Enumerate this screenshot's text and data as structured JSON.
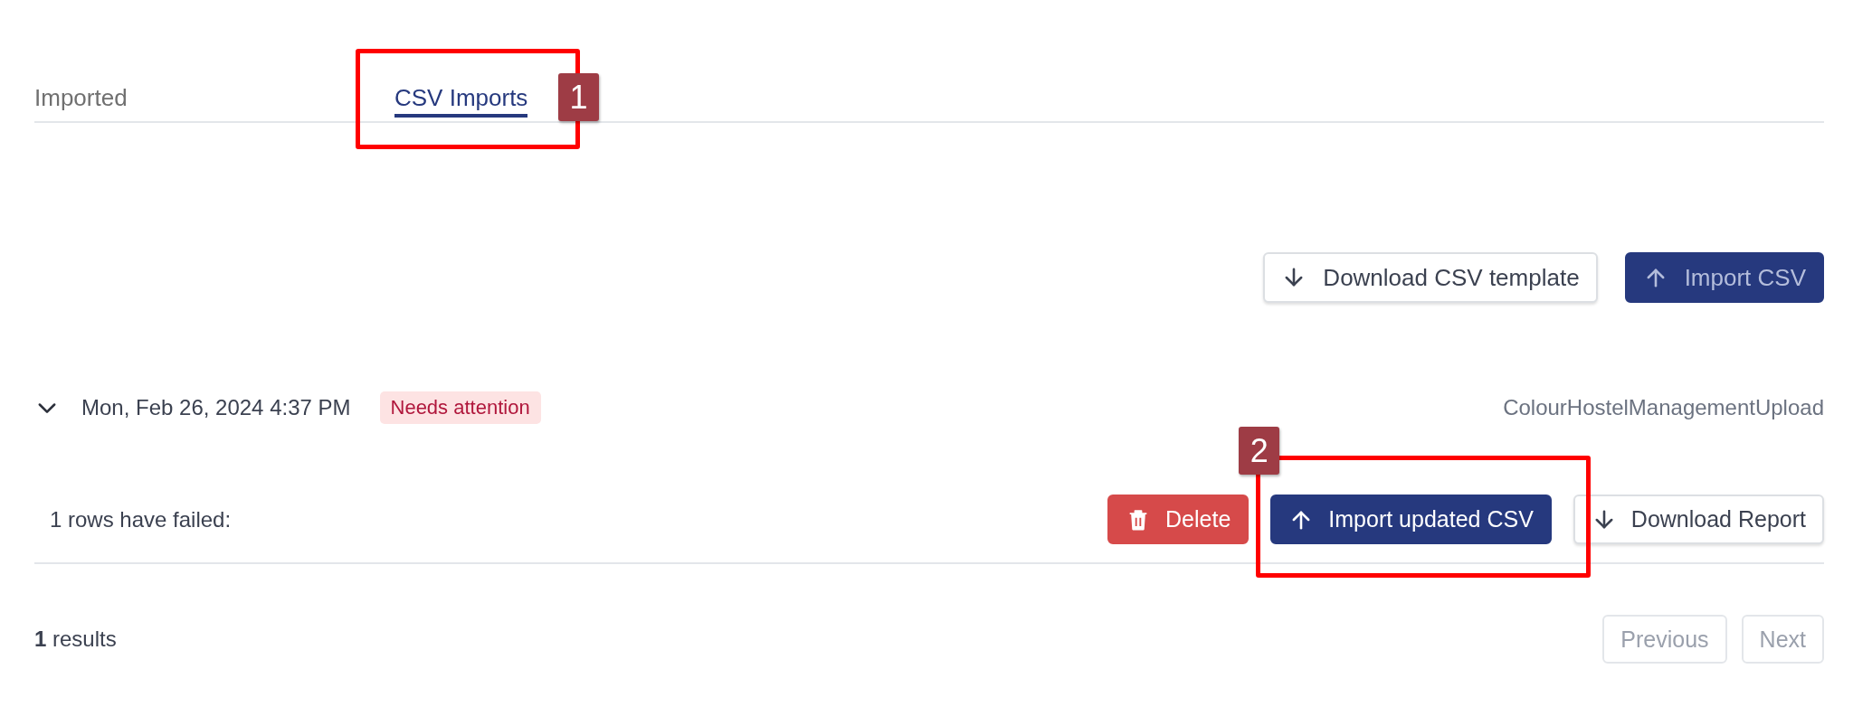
{
  "tabs": [
    {
      "label": "Imported",
      "selected": false
    },
    {
      "label": "CSV Imports",
      "selected": true,
      "annotation": "1"
    }
  ],
  "toolbar": {
    "buttons": [
      {
        "label": "Download CSV template",
        "kind": "download"
      },
      {
        "label": "Import CSV",
        "kind": "import"
      }
    ]
  },
  "imports": [
    {
      "expanded": true,
      "date": "Mon, Feb 26, 2024 4:37 PM",
      "status": "Needs attention",
      "file": "ColourHostelManagementUpload",
      "summary": "1 rows have failed:",
      "actions": [
        {
          "label": "Delete",
          "kind": "delete"
        },
        {
          "label": "Import updated CSV",
          "kind": "import",
          "annotation": "2"
        },
        {
          "label": "Download Report",
          "kind": "download"
        }
      ]
    }
  ],
  "footer": {
    "count": "**1** results",
    "pagination": [
      {
        "label": "Previous",
        "disabled": true
      },
      {
        "label": "Next",
        "disabled": true
      }
    ]
  }
}
